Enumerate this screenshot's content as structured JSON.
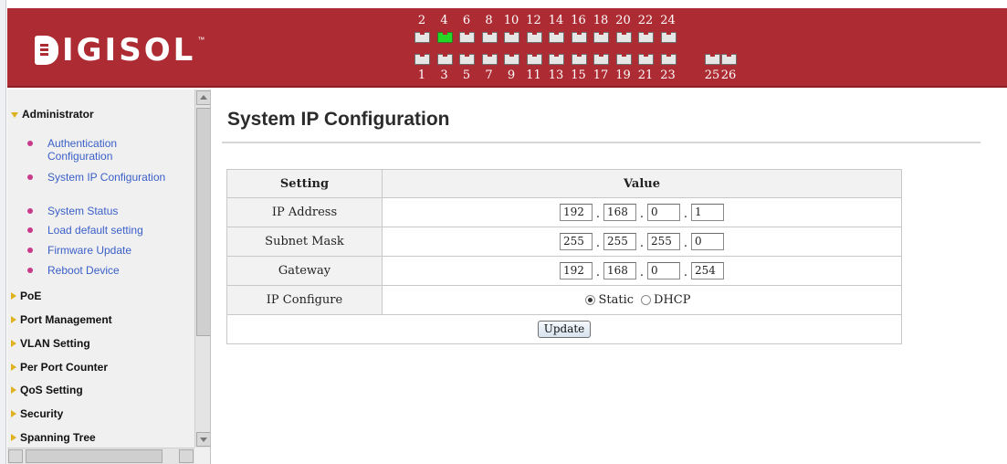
{
  "brand": {
    "logo_text": "IGISOL",
    "logo_tm": "™"
  },
  "ports": {
    "top_numbers": [
      "2",
      "4",
      "6",
      "8",
      "10",
      "12",
      "14",
      "16",
      "18",
      "20",
      "22",
      "24"
    ],
    "bottom_numbers": [
      "1",
      "3",
      "5",
      "7",
      "9",
      "11",
      "13",
      "15",
      "17",
      "19",
      "21",
      "23"
    ],
    "uplink_numbers": [
      "25",
      "26"
    ],
    "active_ports": [
      "4"
    ],
    "active_color": "#26d826"
  },
  "sidebar": {
    "groups": [
      {
        "label": "Administrator",
        "expanded": true,
        "items": [
          {
            "label": "Authentication Configuration"
          },
          {
            "label": "System IP Configuration"
          },
          {
            "label": "System Status"
          },
          {
            "label": "Load default setting"
          },
          {
            "label": "Firmware Update"
          },
          {
            "label": "Reboot Device"
          }
        ]
      },
      {
        "label": "PoE"
      },
      {
        "label": "Port Management"
      },
      {
        "label": "VLAN Setting"
      },
      {
        "label": "Per Port Counter"
      },
      {
        "label": "QoS Setting"
      },
      {
        "label": "Security"
      },
      {
        "label": "Spanning Tree"
      }
    ]
  },
  "main": {
    "title": "System IP Configuration",
    "table": {
      "headers": {
        "setting": "Setting",
        "value": "Value"
      },
      "rows": {
        "ip_address": {
          "label": "IP Address",
          "octets": [
            "192",
            "168",
            "0",
            "1"
          ]
        },
        "subnet_mask": {
          "label": "Subnet Mask",
          "octets": [
            "255",
            "255",
            "255",
            "0"
          ]
        },
        "gateway": {
          "label": "Gateway",
          "octets": [
            "192",
            "168",
            "0",
            "254"
          ]
        },
        "ip_configure": {
          "label": "IP Configure",
          "options": [
            "Static",
            "DHCP"
          ],
          "selected": "Static"
        }
      },
      "update_label": "Update"
    }
  },
  "colors": {
    "header_bg": "#ad2c33",
    "link": "#3a5fc8",
    "bullet": "#c83a8a"
  }
}
